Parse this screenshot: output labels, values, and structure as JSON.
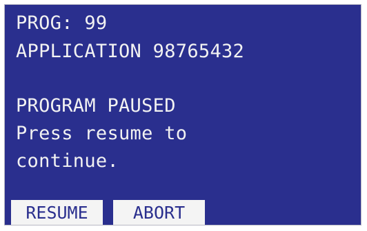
{
  "screen": {
    "lines": [
      "PROG: 99",
      "APPLICATION 98765432",
      "",
      "PROGRAM PAUSED",
      "Press resume to",
      "continue."
    ]
  },
  "softkeys": {
    "resume_label": "RESUME",
    "abort_label": "ABORT"
  },
  "colors": {
    "screen_background": "#2a2f8e",
    "text": "#f2f2f2",
    "softkey_background": "#f4f4f4",
    "softkey_text": "#2a2f8e"
  }
}
